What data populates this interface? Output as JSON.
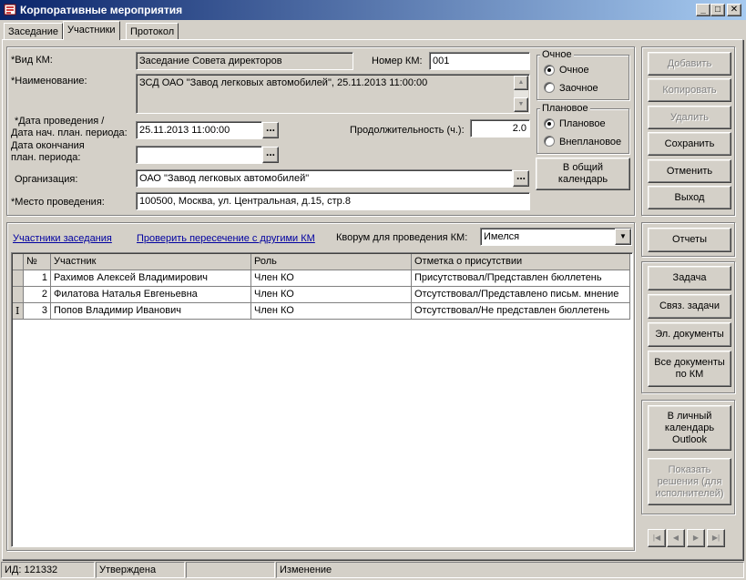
{
  "window": {
    "title": "Корпоративные мероприятия",
    "min_glyph": "_",
    "max_glyph": "□",
    "close_glyph": "✕"
  },
  "tabs": [
    {
      "label": "Заседание"
    },
    {
      "label": "Участники"
    },
    {
      "label": "Протокол"
    }
  ],
  "form": {
    "vid_km_label": "*Вид КМ:",
    "vid_km_value": "Заседание Совета директоров",
    "nomer_km_label": "Номер КМ:",
    "nomer_km_value": "001",
    "naimenovanie_label": "*Наименование:",
    "naimenovanie_value": "ЗСД ОАО \"Завод легковых автомобилей\", 25.11.2013 11:00:00",
    "date_label_1": "*Дата проведения /",
    "date_label_2": "Дата нач. план. периода:",
    "date_value": "25.11.2013 11:00:00",
    "end_label_1": "Дата окончания",
    "end_label_2": "план. периода:",
    "end_value": "",
    "duration_label": "Продолжительность (ч.):",
    "duration_value": "2.0",
    "org_label": "Организация:",
    "org_value": "ОАО \"Завод легковых автомобилей\"",
    "place_label": "*Место проведения:",
    "place_value": "100500, Москва, ул. Центральная, д.15, стр.8",
    "dots": "..."
  },
  "group_ochnoe": {
    "title": "Очное",
    "options": [
      "Очное",
      "Заочное"
    ],
    "selected": "Очное"
  },
  "group_planovoe": {
    "title": "Плановое",
    "options": [
      "Плановое",
      "Внеплановое"
    ],
    "selected": "Плановое"
  },
  "calendar_button": "В общий календарь",
  "right_buttons": {
    "add": "Добавить",
    "copy": "Копировать",
    "delete": "Удалить",
    "save": "Сохранить",
    "cancel": "Отменить",
    "exit": "Выход",
    "reports": "Отчеты",
    "task": "Задача",
    "linked_tasks": "Связ. задачи",
    "el_docs": "Эл. документы",
    "all_docs": "Все документы по КМ",
    "outlook": "В личный календарь Outlook",
    "show_decisions": "Показать решения (для исполнителей)"
  },
  "participants": {
    "link_participants": "Участники заседания",
    "link_check": "Проверить пересечение с другими КМ",
    "quorum_label": "Кворум для проведения КМ:",
    "quorum_value": "Имелся",
    "columns": [
      "№",
      "Участник",
      "Роль",
      "Отметка о присутствии"
    ],
    "rows": [
      {
        "num": "1",
        "name": "Рахимов Алексей Владимирович",
        "role": "Член КО",
        "mark": "Присутствовал/Представлен бюллетень",
        "indicator": ""
      },
      {
        "num": "2",
        "name": "Филатова Наталья Евгеньевна",
        "role": "Член КО",
        "mark": "Отсутствовал/Представлено письм. мнение",
        "indicator": ""
      },
      {
        "num": "3",
        "name": "Попов Владимир Иванович",
        "role": "Член КО",
        "mark": "Отсутствовал/Не представлен бюллетень",
        "indicator": "I"
      }
    ]
  },
  "nav_glyphs": [
    "|◀",
    "◀",
    "▶",
    "▶|"
  ],
  "status": {
    "id": "ИД: 121332",
    "state": "Утверждена",
    "empty": "",
    "mode": "Изменение"
  }
}
